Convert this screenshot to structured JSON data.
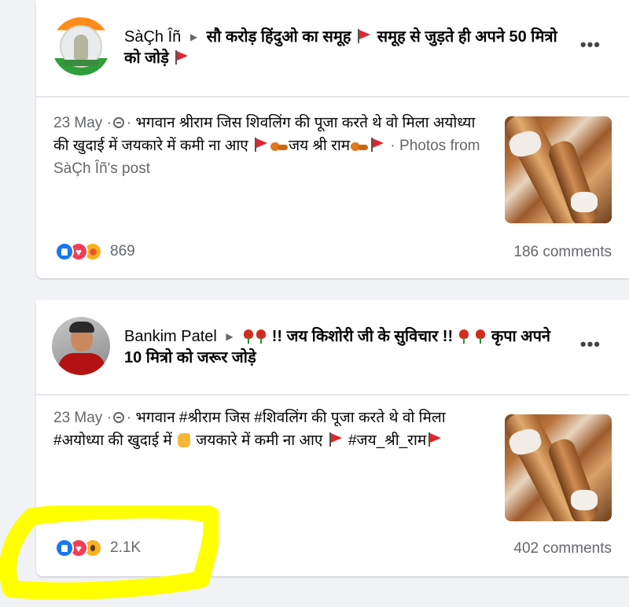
{
  "posts": [
    {
      "author": "SàÇh Îñ",
      "group_text": "सौ करोड़ हिंदुओ का समूह",
      "group_text_2": "समूह से जुड़ते ही अपने 50 मित्रो को जोड़े",
      "date": "23 May",
      "body_1": "भगवान श्रीराम जिस शिवलिंग की पूजा करते थे वो मिला अयोध्या की खुदाई में जयकारे में कमी ना आए",
      "body_2": "जय श्री राम",
      "photos_link": "Photos from SàÇh Îñ's post",
      "reaction_count": "869",
      "comments": "186 comments",
      "reactions": [
        "like",
        "love",
        "care"
      ]
    },
    {
      "author": "Bankim Patel",
      "group_text": "!! जय किशोरी जी के सुविचार !!",
      "group_text_2": "कृपा अपने 10 मित्रो को जरूर जोड़े",
      "date": "23 May",
      "body_1": "भगवान #श्रीराम जिस #शिवलिंग की पूजा करते थे वो मिला #अयोध्या की खुदाई में",
      "body_2": "जयकारे में कमी ना आए",
      "body_3": "#जय_श्री_राम",
      "reaction_count": "2.1K",
      "comments": "402 comments",
      "reactions": [
        "like",
        "love",
        "wow"
      ]
    }
  ],
  "colors": {
    "highlight": "#ffff00",
    "flag": "#e0262e",
    "like": "#1877f2",
    "love": "#f33e58"
  },
  "icons": [
    "globe-icon",
    "more-options-icon",
    "flag-icon",
    "rose-icon",
    "lion-icon",
    "pointing-hand-icon",
    "right-arrow-icon"
  ]
}
